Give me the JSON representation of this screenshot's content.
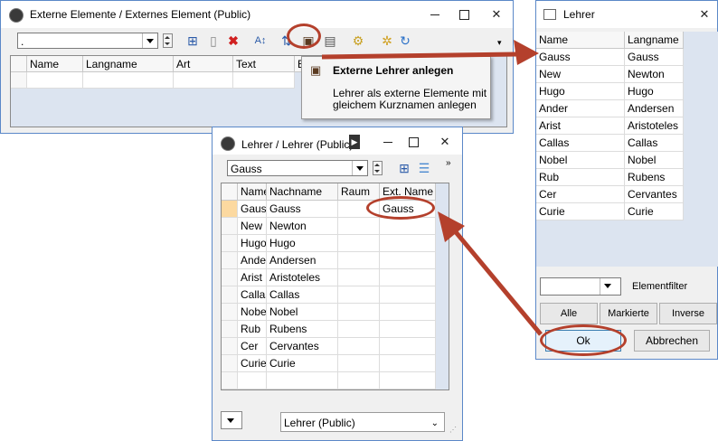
{
  "externe_window": {
    "title": "Externe Elemente / Externes Element (Public)",
    "combo_value": ".",
    "columns": [
      "Name",
      "Langname",
      "Art",
      "Text",
      "B"
    ]
  },
  "popup": {
    "title": "Externe Lehrer anlegen",
    "description_line1": "Lehrer als externe Elemente mit",
    "description_line2": "gleichem Kurznamen anlegen"
  },
  "lehrer_window": {
    "title": "Lehrer / Lehrer (Public)",
    "combo_value": "Gauss",
    "columns": [
      "Name",
      "Nachname",
      "Raum",
      "Ext. Name"
    ],
    "rows": [
      {
        "name": "Gauss",
        "nachname": "Gauss",
        "raum": "",
        "ext": "Gauss"
      },
      {
        "name": "New",
        "nachname": "Newton",
        "raum": "",
        "ext": ""
      },
      {
        "name": "Hugo",
        "nachname": "Hugo",
        "raum": "",
        "ext": ""
      },
      {
        "name": "Ander",
        "nachname": "Andersen",
        "raum": "",
        "ext": ""
      },
      {
        "name": "Arist",
        "nachname": "Aristoteles",
        "raum": "",
        "ext": ""
      },
      {
        "name": "Callas",
        "nachname": "Callas",
        "raum": "",
        "ext": ""
      },
      {
        "name": "Nobel",
        "nachname": "Nobel",
        "raum": "",
        "ext": ""
      },
      {
        "name": "Rub",
        "nachname": "Rubens",
        "raum": "",
        "ext": ""
      },
      {
        "name": "Cer",
        "nachname": "Cervantes",
        "raum": "",
        "ext": ""
      },
      {
        "name": "Curie",
        "nachname": "Curie",
        "raum": "",
        "ext": ""
      }
    ],
    "footer_combo": "Lehrer (Public)"
  },
  "dialog": {
    "title": "Lehrer",
    "columns": [
      "Name",
      "Langname"
    ],
    "rows": [
      {
        "name": "Gauss",
        "lang": "Gauss"
      },
      {
        "name": "New",
        "lang": "Newton"
      },
      {
        "name": "Hugo",
        "lang": "Hugo"
      },
      {
        "name": "Ander",
        "lang": "Andersen"
      },
      {
        "name": "Arist",
        "lang": "Aristoteles"
      },
      {
        "name": "Callas",
        "lang": "Callas"
      },
      {
        "name": "Nobel",
        "lang": "Nobel"
      },
      {
        "name": "Rub",
        "lang": "Rubens"
      },
      {
        "name": "Cer",
        "lang": "Cervantes"
      },
      {
        "name": "Curie",
        "lang": "Curie"
      }
    ],
    "elementfilter_label": "Elementfilter",
    "btn_alle": "Alle",
    "btn_markierte": "Markierte",
    "btn_inverse": "Inverse",
    "btn_ok": "Ok",
    "btn_abbrechen": "Abbrechen"
  },
  "colors": {
    "highlight": "#b4402c",
    "window_border": "#5b88c8",
    "selection_row": "#fcd9a0"
  }
}
